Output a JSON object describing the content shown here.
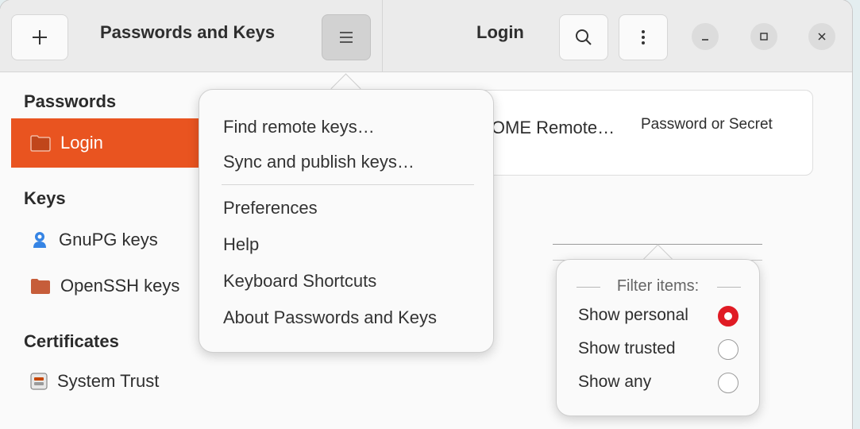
{
  "header": {
    "left_title": "Passwords and Keys",
    "right_title": "Login",
    "add_icon": "plus-icon",
    "menu_icon": "hamburger-menu-icon",
    "search_icon": "search-icon",
    "more_icon": "vertical-dots-icon"
  },
  "window_controls": {
    "minimize": "–",
    "maximize": "□",
    "close": "×"
  },
  "sidebar": {
    "sections": [
      {
        "title": "Passwords",
        "items": [
          {
            "label": "Login",
            "icon": "folder-icon",
            "selected": true
          }
        ]
      },
      {
        "title": "Keys",
        "items": [
          {
            "label": "GnuPG keys",
            "icon": "gnupg-key-icon"
          },
          {
            "label": "OpenSSH keys",
            "icon": "folder-icon"
          }
        ]
      },
      {
        "title": "Certificates",
        "items": [
          {
            "label": "System Trust",
            "icon": "certificate-icon"
          }
        ]
      }
    ]
  },
  "main": {
    "item_name": "NOME Remote…",
    "item_type": "Password or Secret"
  },
  "app_menu": {
    "items": [
      "Find remote keys…",
      "Sync and publish keys…",
      "Preferences",
      "Help",
      "Keyboard Shortcuts",
      "About Passwords and Keys"
    ]
  },
  "filter_menu": {
    "title": "Filter items:",
    "options": [
      {
        "label": "Show personal",
        "selected": true
      },
      {
        "label": "Show trusted",
        "selected": false
      },
      {
        "label": "Show any",
        "selected": false
      }
    ]
  },
  "colors": {
    "accent": "#e95420",
    "radio_selected": "#e01b24",
    "folder": "#c65d3a"
  }
}
